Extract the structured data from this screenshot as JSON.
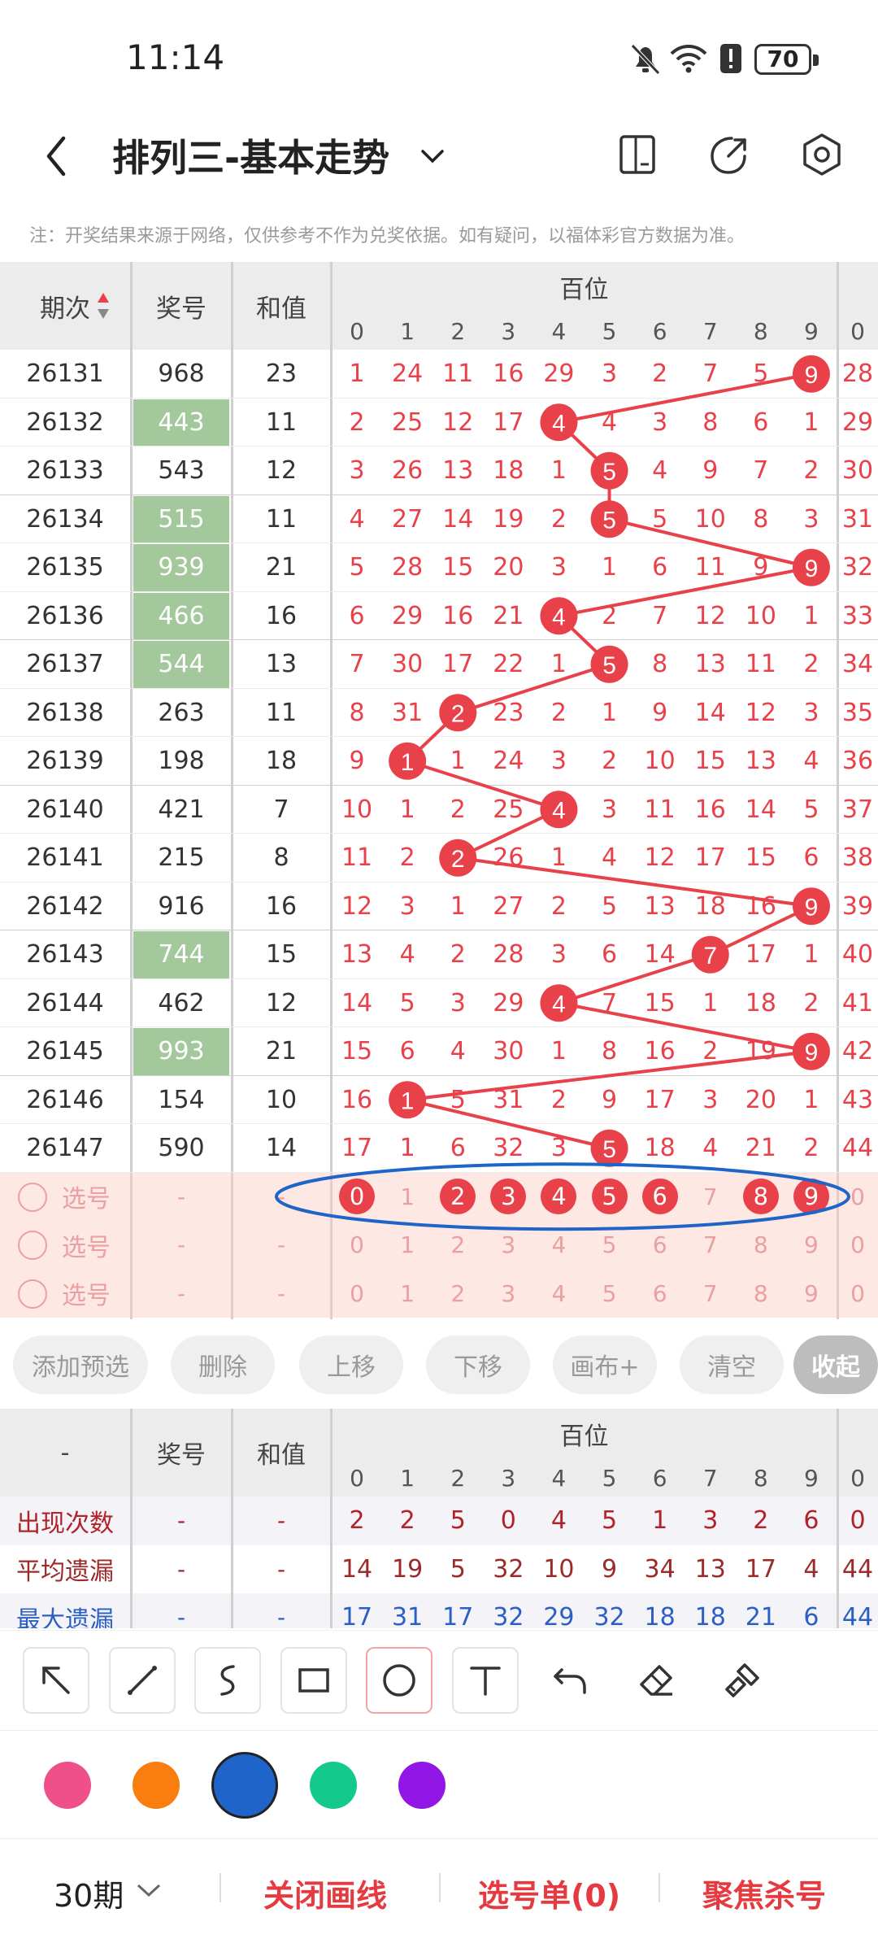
{
  "status_bar": {
    "time": "11:14",
    "battery": "70"
  },
  "header": {
    "title": "排列三-基本走势"
  },
  "note": "注：开奖结果来源于网络，仅供参考不作为兑奖依据。如有疑问，以福体彩官方数据为准。",
  "table": {
    "col_issue": "期次",
    "col_award": "奖号",
    "col_sum": "和值",
    "group_label": "百位",
    "digits": [
      "0",
      "1",
      "2",
      "3",
      "4",
      "5",
      "6",
      "7",
      "8",
      "9"
    ],
    "extra_col_digit": "0",
    "rows": [
      {
        "issue": "26131",
        "award": "968",
        "sum": "23",
        "hi": false,
        "vals": [
          "1",
          "24",
          "11",
          "16",
          "29",
          "3",
          "2",
          "7",
          "5",
          "9"
        ],
        "extra": "28",
        "hit": 9
      },
      {
        "issue": "26132",
        "award": "443",
        "sum": "11",
        "hi": true,
        "vals": [
          "2",
          "25",
          "12",
          "17",
          "4",
          "4",
          "3",
          "8",
          "6",
          "1"
        ],
        "extra": "29",
        "hit": 4
      },
      {
        "issue": "26133",
        "award": "543",
        "sum": "12",
        "hi": false,
        "vals": [
          "3",
          "26",
          "13",
          "18",
          "1",
          "5",
          "4",
          "9",
          "7",
          "2"
        ],
        "extra": "30",
        "hit": 5
      },
      {
        "issue": "26134",
        "award": "515",
        "sum": "11",
        "hi": true,
        "vals": [
          "4",
          "27",
          "14",
          "19",
          "2",
          "5",
          "5",
          "10",
          "8",
          "3"
        ],
        "extra": "31",
        "hit": 5
      },
      {
        "issue": "26135",
        "award": "939",
        "sum": "21",
        "hi": true,
        "vals": [
          "5",
          "28",
          "15",
          "20",
          "3",
          "1",
          "6",
          "11",
          "9",
          "9"
        ],
        "extra": "32",
        "hit": 9
      },
      {
        "issue": "26136",
        "award": "466",
        "sum": "16",
        "hi": true,
        "vals": [
          "6",
          "29",
          "16",
          "21",
          "4",
          "2",
          "7",
          "12",
          "10",
          "1"
        ],
        "extra": "33",
        "hit": 4
      },
      {
        "issue": "26137",
        "award": "544",
        "sum": "13",
        "hi": true,
        "vals": [
          "7",
          "30",
          "17",
          "22",
          "1",
          "5",
          "8",
          "13",
          "11",
          "2"
        ],
        "extra": "34",
        "hit": 5
      },
      {
        "issue": "26138",
        "award": "263",
        "sum": "11",
        "hi": false,
        "vals": [
          "8",
          "31",
          "2",
          "23",
          "2",
          "1",
          "9",
          "14",
          "12",
          "3"
        ],
        "extra": "35",
        "hit": 2
      },
      {
        "issue": "26139",
        "award": "198",
        "sum": "18",
        "hi": false,
        "vals": [
          "9",
          "1",
          "1",
          "24",
          "3",
          "2",
          "10",
          "15",
          "13",
          "4"
        ],
        "extra": "36",
        "hit": 1
      },
      {
        "issue": "26140",
        "award": "421",
        "sum": "7",
        "hi": false,
        "vals": [
          "10",
          "1",
          "2",
          "25",
          "4",
          "3",
          "11",
          "16",
          "14",
          "5"
        ],
        "extra": "37",
        "hit": 4
      },
      {
        "issue": "26141",
        "award": "215",
        "sum": "8",
        "hi": false,
        "vals": [
          "11",
          "2",
          "2",
          "26",
          "1",
          "4",
          "12",
          "17",
          "15",
          "6"
        ],
        "extra": "38",
        "hit": 2
      },
      {
        "issue": "26142",
        "award": "916",
        "sum": "16",
        "hi": false,
        "vals": [
          "12",
          "3",
          "1",
          "27",
          "2",
          "5",
          "13",
          "18",
          "16",
          "9"
        ],
        "extra": "39",
        "hit": 9
      },
      {
        "issue": "26143",
        "award": "744",
        "sum": "15",
        "hi": true,
        "vals": [
          "13",
          "4",
          "2",
          "28",
          "3",
          "6",
          "14",
          "7",
          "17",
          "1"
        ],
        "extra": "40",
        "hit": 7
      },
      {
        "issue": "26144",
        "award": "462",
        "sum": "12",
        "hi": false,
        "vals": [
          "14",
          "5",
          "3",
          "29",
          "4",
          "7",
          "15",
          "1",
          "18",
          "2"
        ],
        "extra": "41",
        "hit": 4
      },
      {
        "issue": "26145",
        "award": "993",
        "sum": "21",
        "hi": true,
        "vals": [
          "15",
          "6",
          "4",
          "30",
          "1",
          "8",
          "16",
          "2",
          "19",
          "9"
        ],
        "extra": "42",
        "hit": 9
      },
      {
        "issue": "26146",
        "award": "154",
        "sum": "10",
        "hi": false,
        "vals": [
          "16",
          "1",
          "5",
          "31",
          "2",
          "9",
          "17",
          "3",
          "20",
          "1"
        ],
        "extra": "43",
        "hit": 1
      },
      {
        "issue": "26147",
        "award": "590",
        "sum": "14",
        "hi": false,
        "vals": [
          "17",
          "1",
          "6",
          "32",
          "3",
          "5",
          "18",
          "4",
          "21",
          "2"
        ],
        "extra": "44",
        "hit": 5
      }
    ],
    "select_rows": [
      {
        "label": "选号",
        "award": "-",
        "sum": "-",
        "selected": [
          0,
          2,
          3,
          4,
          5,
          6,
          8,
          9
        ],
        "extra": "0"
      },
      {
        "label": "选号",
        "award": "-",
        "sum": "-",
        "selected": [],
        "extra": "0"
      },
      {
        "label": "选号",
        "award": "-",
        "sum": "-",
        "selected": [],
        "extra": "0"
      }
    ]
  },
  "buttons": [
    "添加预选",
    "删除",
    "上移",
    "下移",
    "画布+",
    "清空",
    "收起"
  ],
  "stats": {
    "col_issue": "-",
    "col_award": "奖号",
    "col_sum": "和值",
    "group_label": "百位",
    "rows": [
      {
        "label": "出现次数",
        "award": "-",
        "sum": "-",
        "vals": [
          "2",
          "2",
          "5",
          "0",
          "4",
          "5",
          "1",
          "3",
          "2",
          "6"
        ],
        "extra": "0",
        "color": "#b2222a"
      },
      {
        "label": "平均遗漏",
        "award": "-",
        "sum": "-",
        "vals": [
          "14",
          "19",
          "5",
          "32",
          "10",
          "9",
          "34",
          "13",
          "17",
          "4"
        ],
        "extra": "44",
        "color": "#9b2b2b"
      },
      {
        "label": "最大遗漏",
        "award": "-",
        "sum": "-",
        "vals": [
          "17",
          "31",
          "17",
          "32",
          "29",
          "32",
          "18",
          "18",
          "21",
          "6"
        ],
        "extra": "44",
        "color": "#2b5fc4"
      }
    ]
  },
  "tools": [
    "arrow-tool",
    "line-tool",
    "curve-tool",
    "rectangle-tool",
    "circle-tool",
    "text-tool",
    "undo-tool",
    "eraser-tool",
    "clear-brush-tool"
  ],
  "colors": [
    "#f0508a",
    "#fa7d0f",
    "#1f64c8",
    "#14c98c",
    "#9217e6"
  ],
  "colors_selected_index": 2,
  "bottom": {
    "period": "30期",
    "close_lines": "关闭画线",
    "pick_list": "选号单(0)",
    "focus_kill": "聚焦杀号"
  },
  "accent": "#e8414a"
}
